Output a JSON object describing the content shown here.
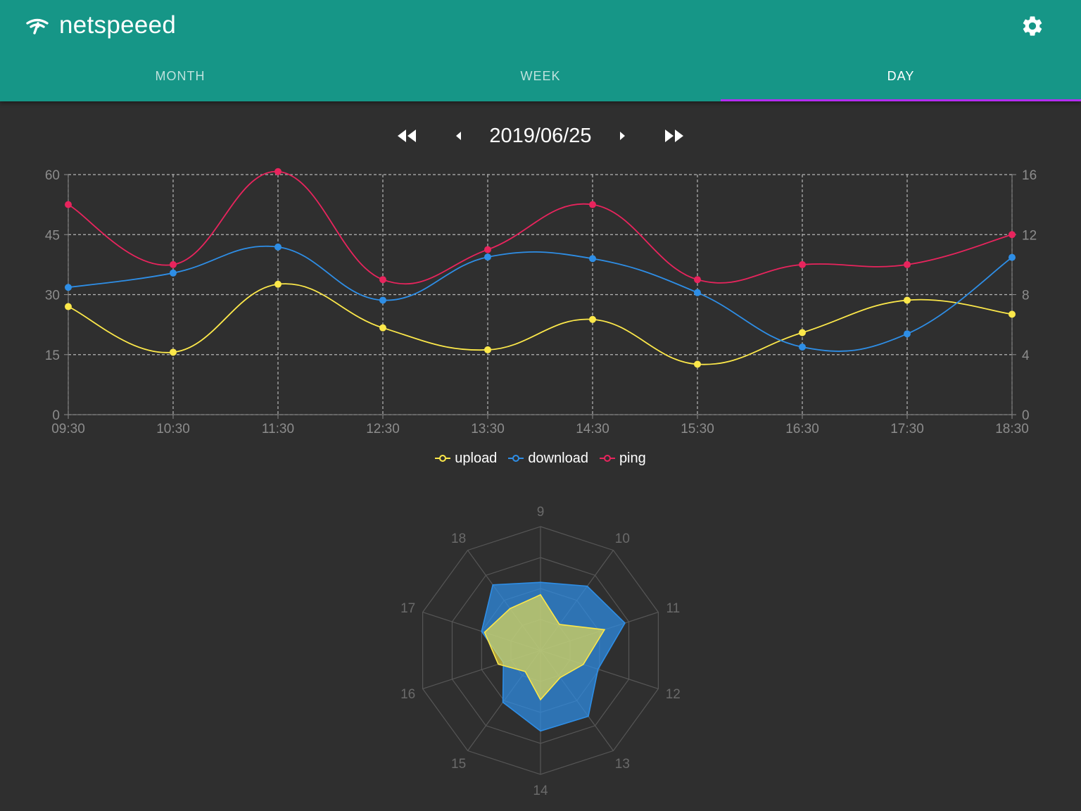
{
  "app": {
    "title": "netspeeed"
  },
  "icons": {
    "brand": "wifi-speed-icon",
    "settings": "gear-icon"
  },
  "tabs": [
    {
      "label": "MONTH",
      "active": false
    },
    {
      "label": "WEEK",
      "active": false
    },
    {
      "label": "DAY",
      "active": true
    }
  ],
  "date_nav": {
    "date": "2019/06/25",
    "buttons": [
      "fast-rewind-icon",
      "previous-icon",
      "next-icon",
      "fast-forward-icon"
    ]
  },
  "colors": {
    "appbar": "#169687",
    "tab_indicator": "#b32ef0",
    "background": "#2f2f2f",
    "upload": "#fce84a",
    "download": "#2e8ee6",
    "ping": "#e8245d"
  },
  "chart_data": [
    {
      "type": "line",
      "x": [
        "09:30",
        "10:30",
        "11:30",
        "12:30",
        "13:30",
        "14:30",
        "15:30",
        "16:30",
        "17:30",
        "18:30"
      ],
      "y_left_ticks": [
        "0",
        "15",
        "30",
        "45",
        "60"
      ],
      "y_right_ticks": [
        "0",
        "4",
        "8",
        "12",
        "16"
      ],
      "ylim_left": [
        0,
        60
      ],
      "ylim_right": [
        0,
        16
      ],
      "grid": true,
      "legend_position": "bottom-center",
      "series": [
        {
          "name": "upload",
          "axis": "left",
          "color": "#fce84a",
          "values": [
            27,
            15.6,
            32.6,
            21.7,
            16.2,
            23.8,
            12.6,
            20.5,
            28.6,
            25.1
          ]
        },
        {
          "name": "download",
          "axis": "left",
          "color": "#2e8ee6",
          "values": [
            31.8,
            35.4,
            41.9,
            28.6,
            39.4,
            39,
            30.5,
            16.9,
            20.2,
            39.3
          ]
        },
        {
          "name": "ping",
          "axis": "right",
          "color": "#e8245d",
          "values": [
            14,
            10,
            16.2,
            9,
            11,
            14,
            9,
            10,
            10,
            12
          ]
        }
      ]
    },
    {
      "type": "radar",
      "axes": [
        "9",
        "10",
        "11",
        "12",
        "13",
        "14",
        "15",
        "16",
        "17",
        "18"
      ],
      "rmax": 60,
      "grid_levels": 4,
      "series": [
        {
          "name": "download",
          "color": "#2e8ee6",
          "values": [
            33,
            38.5,
            43,
            29.3,
            39.4,
            39,
            31,
            18.9,
            30,
            39.3
          ]
        },
        {
          "name": "upload",
          "color": "#fce84a",
          "values": [
            27,
            15.6,
            32.6,
            21.8,
            16.2,
            23.8,
            12.6,
            21.5,
            28.5,
            25.1
          ]
        }
      ]
    }
  ]
}
